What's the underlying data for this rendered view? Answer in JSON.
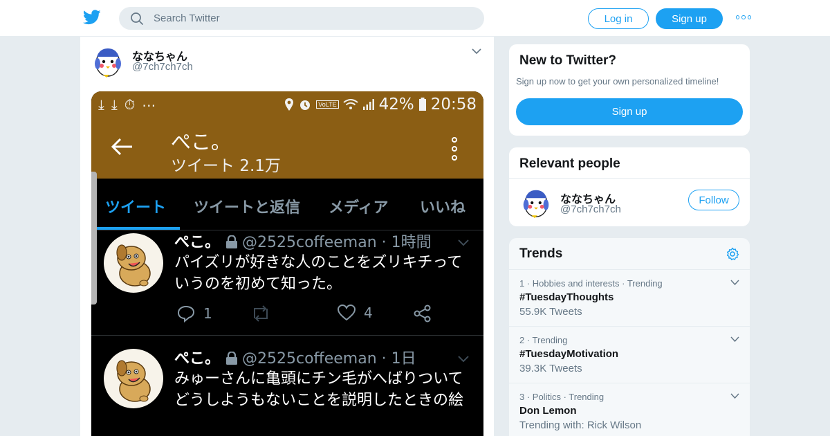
{
  "header": {
    "search_placeholder": "Search Twitter",
    "login_label": "Log in",
    "signup_label": "Sign up",
    "brand_color": "#1da1f2"
  },
  "tweet": {
    "author_name": "ななちゃん",
    "author_handle": "@7ch7ch7ch",
    "media": {
      "status_bar": {
        "battery": "42%",
        "time": "20:58",
        "volte": "VoLTE"
      },
      "profile_title": "ぺこ。",
      "profile_subtitle": "ツイート 2.1万",
      "tabs": [
        "ツイート",
        "ツイートと返信",
        "メディア",
        "いいね"
      ],
      "active_tab": 0,
      "tweets": [
        {
          "name": "ぺこ。",
          "handle": "@2525coffeeman",
          "time": "1時間",
          "text": "パイズリが好きな人のことをズリキチっていうのを初めて知った。",
          "replies": "1",
          "likes": "4"
        },
        {
          "name": "ぺこ。",
          "handle": "@2525coffeeman",
          "time": "1日",
          "text": "みゅーさんに亀頭にチン毛がへばりついてどうしようもないことを説明したときの絵"
        }
      ]
    }
  },
  "sidebar": {
    "new_to_twitter": {
      "title": "New to Twitter?",
      "subtitle": "Sign up now to get your own personalized timeline!",
      "button": "Sign up"
    },
    "relevant_people": {
      "title": "Relevant people",
      "name": "ななちゃん",
      "handle": "@7ch7ch7ch",
      "follow_label": "Follow"
    },
    "trends": {
      "title": "Trends",
      "items": [
        {
          "meta": "1 · Hobbies and interests · Trending",
          "name": "#TuesdayThoughts",
          "count": "55.9K Tweets"
        },
        {
          "meta": "2 · Trending",
          "name": "#TuesdayMotivation",
          "count": "39.3K Tweets"
        },
        {
          "meta": "3 · Politics · Trending",
          "name": "Don Lemon",
          "count": "Trending with: Rick Wilson"
        }
      ]
    }
  }
}
